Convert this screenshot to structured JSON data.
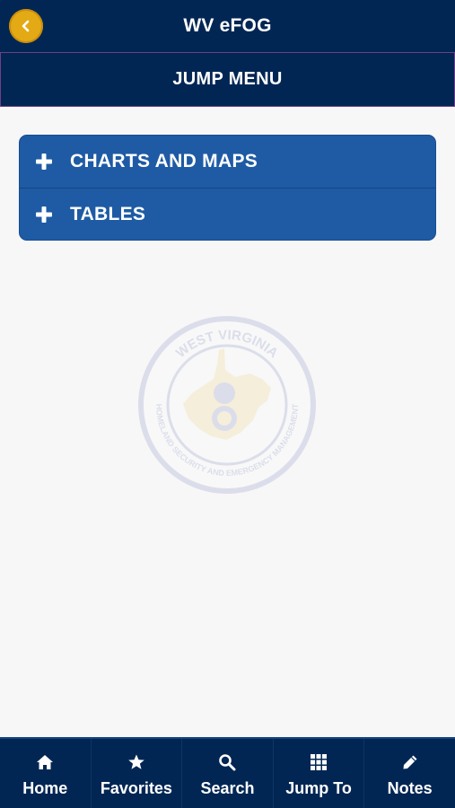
{
  "header": {
    "title": "WV eFOG",
    "back_icon": "chevron-left-icon",
    "accent_color": "#e3aa16",
    "background_color": "#022654"
  },
  "subheader": {
    "title": "JUMP MENU"
  },
  "accordion": {
    "color": "#1e5ba4",
    "items": [
      {
        "label": "CHARTS AND MAPS",
        "icon": "plus-icon",
        "expanded": false
      },
      {
        "label": "TABLES",
        "icon": "plus-icon",
        "expanded": false
      }
    ]
  },
  "watermark": {
    "seal_top_text": "WEST VIRGINIA",
    "seal_bottom_text": "HOMELAND SECURITY AND EMERGENCY MANAGEMENT"
  },
  "tabbar": {
    "tabs": [
      {
        "label": "Home",
        "icon": "home-icon"
      },
      {
        "label": "Favorites",
        "icon": "star-icon"
      },
      {
        "label": "Search",
        "icon": "search-icon"
      },
      {
        "label": "Jump To",
        "icon": "grid-icon"
      },
      {
        "label": "Notes",
        "icon": "pencil-icon"
      }
    ]
  }
}
